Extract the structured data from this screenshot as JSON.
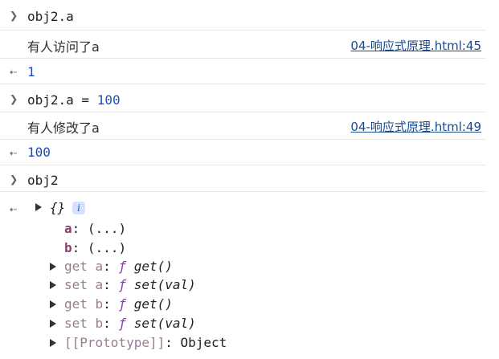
{
  "entries": {
    "cmd1": "obj2.a",
    "log1": {
      "message": "有人访问了a",
      "source": "04-响应式原理.html:45"
    },
    "res1": "1",
    "cmd2_obj": "obj2.a",
    "cmd2_eq": " = ",
    "cmd2_val": "100",
    "log2": {
      "message": "有人修改了a",
      "source": "04-响应式原理.html:49"
    },
    "res2": "100",
    "cmd3": "obj2"
  },
  "object_view": {
    "preview": "{}",
    "info_badge": "i",
    "props": [
      {
        "key": "a",
        "sep": ": ",
        "value": "(...)"
      },
      {
        "key": "b",
        "sep": ": ",
        "value": "(...)"
      }
    ],
    "accessors": [
      {
        "label": "get a",
        "sep": ": ",
        "f": "ƒ",
        "sig": "get()"
      },
      {
        "label": "set a",
        "sep": ": ",
        "f": "ƒ",
        "sig": "set(val)"
      },
      {
        "label": "get b",
        "sep": ": ",
        "f": "ƒ",
        "sig": "get()"
      },
      {
        "label": "set b",
        "sep": ": ",
        "f": "ƒ",
        "sig": "set(val)"
      }
    ],
    "prototype": {
      "label": "[[Prototype]]",
      "sep": ": ",
      "value": "Object"
    }
  },
  "icons": {
    "input_prompt": "chevron-right-icon",
    "result_arrow": "return-arrow-icon",
    "expand": "triangle-right-icon"
  },
  "colors": {
    "number": "#1a4ebf",
    "link": "#1a4a8a",
    "key": "#8e3c6b",
    "accessor": "#9a7c92",
    "function": "#8b3da8",
    "divider": "#e4e8ee"
  }
}
